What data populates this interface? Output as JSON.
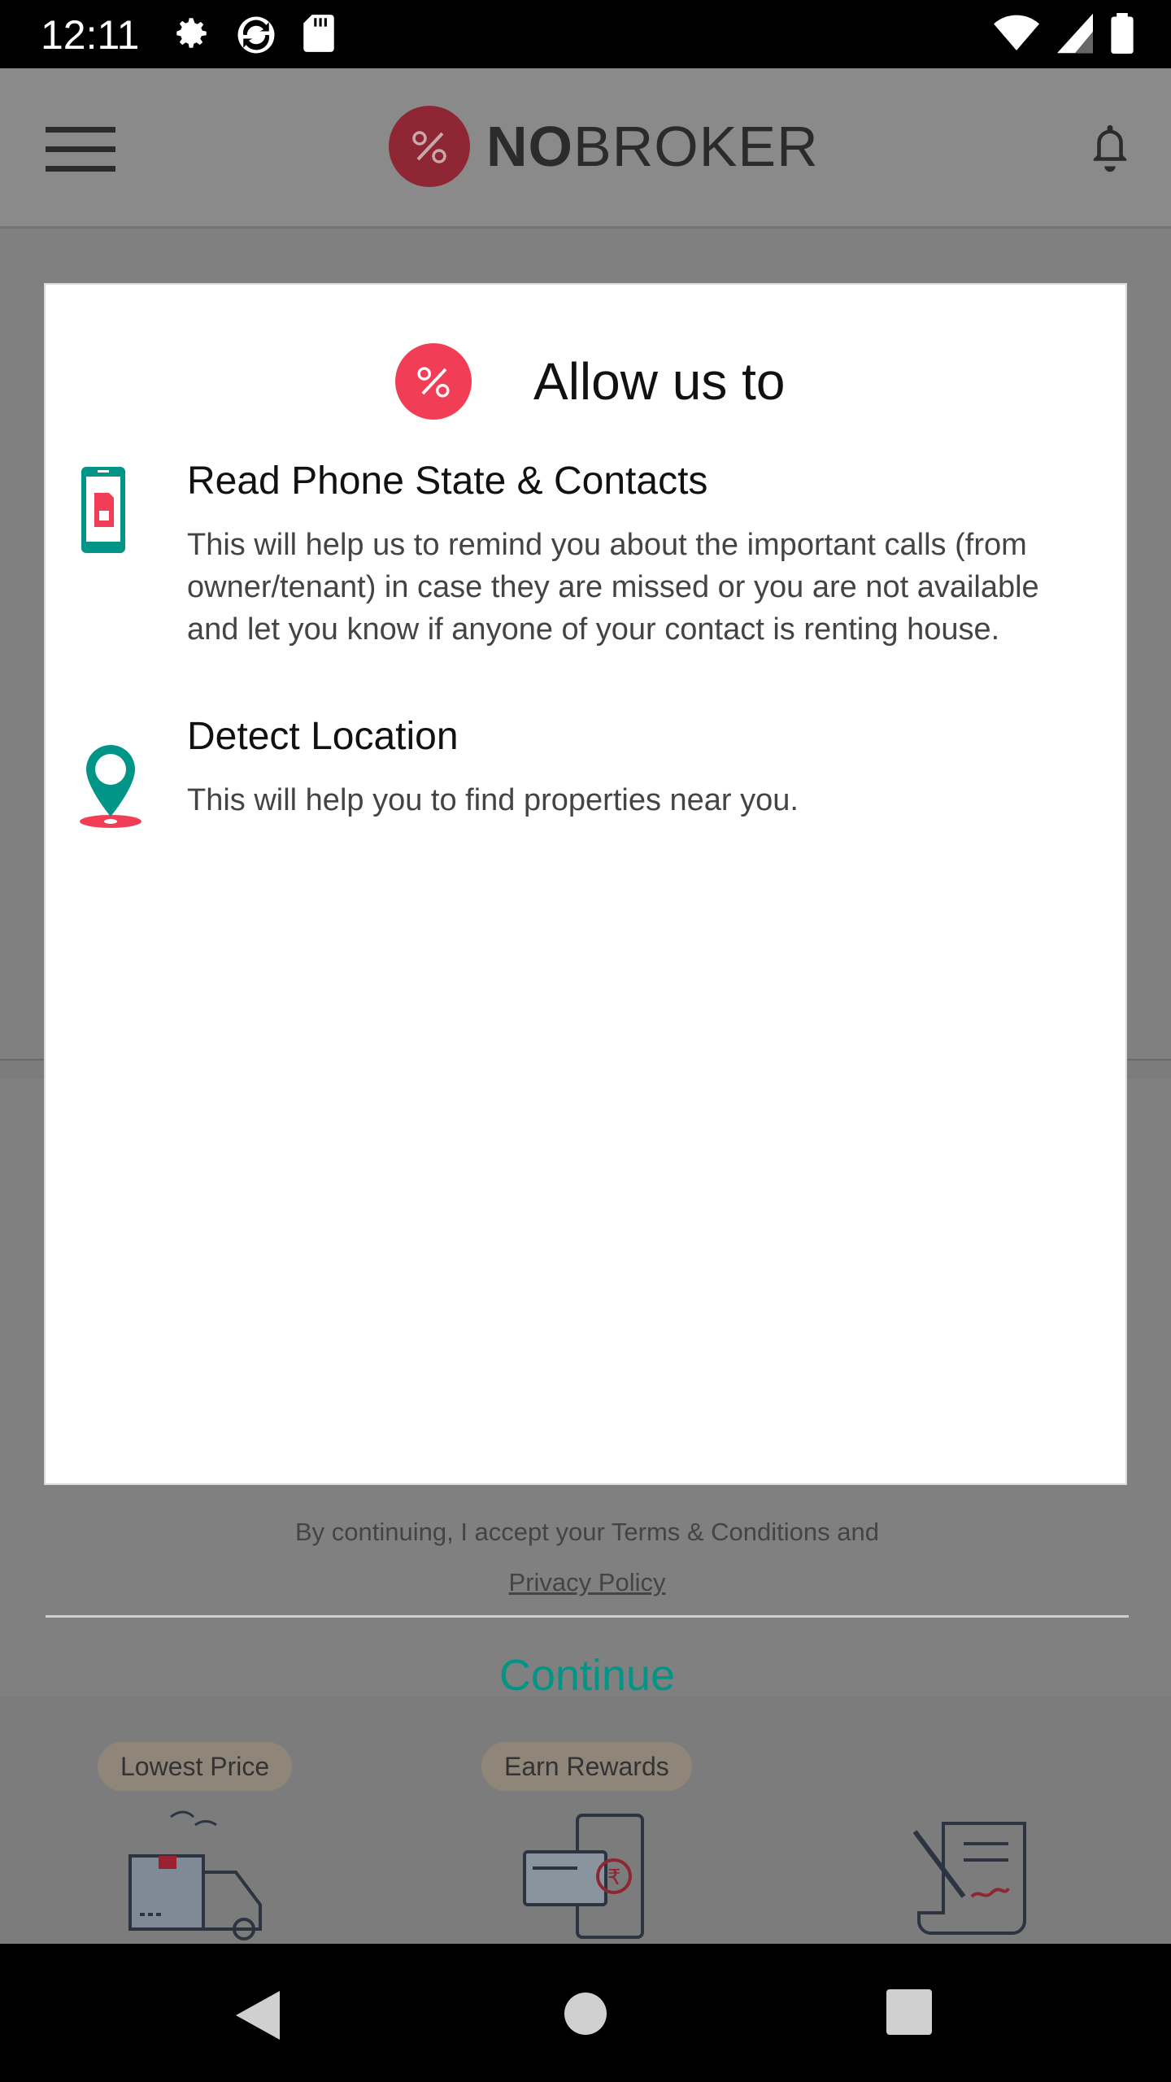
{
  "status_bar": {
    "time": "12:11",
    "icons_left": [
      "gear-icon",
      "sync-icon",
      "sd-card-icon"
    ],
    "icons_right": [
      "wifi-icon",
      "cell-signal-icon",
      "battery-icon"
    ]
  },
  "header": {
    "brand_bold": "NO",
    "brand_rest": "BROKER",
    "menu_icon": "hamburger-icon",
    "notification_icon": "bell-icon"
  },
  "background": {
    "pills": [
      "Lowest Price",
      "Earn Rewards"
    ]
  },
  "dialog": {
    "title": "Allow us to",
    "permissions": [
      {
        "icon": "phone-sim-icon",
        "title": "Read Phone State & Contacts",
        "description": "This will help us to remind you about the important calls (from owner/tenant) in case they are missed or you are not available and let you know if anyone of your contact is renting house."
      },
      {
        "icon": "location-pin-icon",
        "title": "Detect Location",
        "description": "This will help you to find properties near you."
      }
    ],
    "legal_prefix": "By continuing, I accept your ",
    "terms_link": "Terms & Conditions",
    "legal_and": " and",
    "privacy_link": "Privacy Policy",
    "continue_label": "Continue"
  },
  "colors": {
    "brand_red": "#e8334a",
    "teal": "#009587",
    "status_bar": "#000000"
  }
}
